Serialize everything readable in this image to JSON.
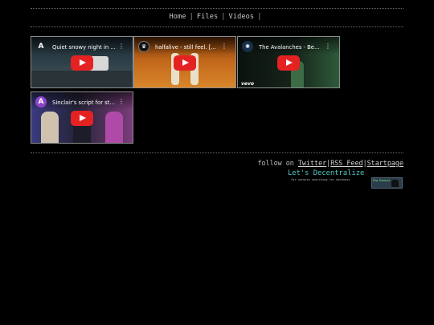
{
  "nav": {
    "home": "Home",
    "files": "Files",
    "videos": "Videos",
    "separator": "|"
  },
  "videos": [
    {
      "title": "Quiet snowy night in ...",
      "channel_icon": "A",
      "icon_name": "channel-a-logo-icon",
      "colors": [
        "#1a2a33",
        "#3b4a52"
      ]
    },
    {
      "title": "halfalive - still feel. [...",
      "channel_icon": "",
      "icon_name": "lion-logo-icon",
      "colors": [
        "#b35a12",
        "#d77d1e"
      ]
    },
    {
      "title": "The Avalanches - Be...",
      "channel_icon": "",
      "icon_name": "avalanches-logo-icon",
      "colors": [
        "#0e1a12",
        "#1f3a28"
      ],
      "watermark": "vevo"
    },
    {
      "title": "Sinclair's script for st...",
      "channel_icon": "A",
      "icon_name": "channel-avatar-a-icon",
      "colors": [
        "#2a2a5a",
        "#6b3a6a"
      ]
    }
  ],
  "footer": {
    "follow_prefix": "follow on ",
    "twitter": "Twitter",
    "rss": "RSS Feed",
    "startpage": "Startpage",
    "separator": "|",
    "headline": "Let's Decentralize",
    "tagline": "for normies searching for darkness",
    "badge_text": "Dig Deeper"
  },
  "colors": {
    "background": "#000000",
    "accent": "#55c9c4",
    "play_button": "#e52222"
  }
}
